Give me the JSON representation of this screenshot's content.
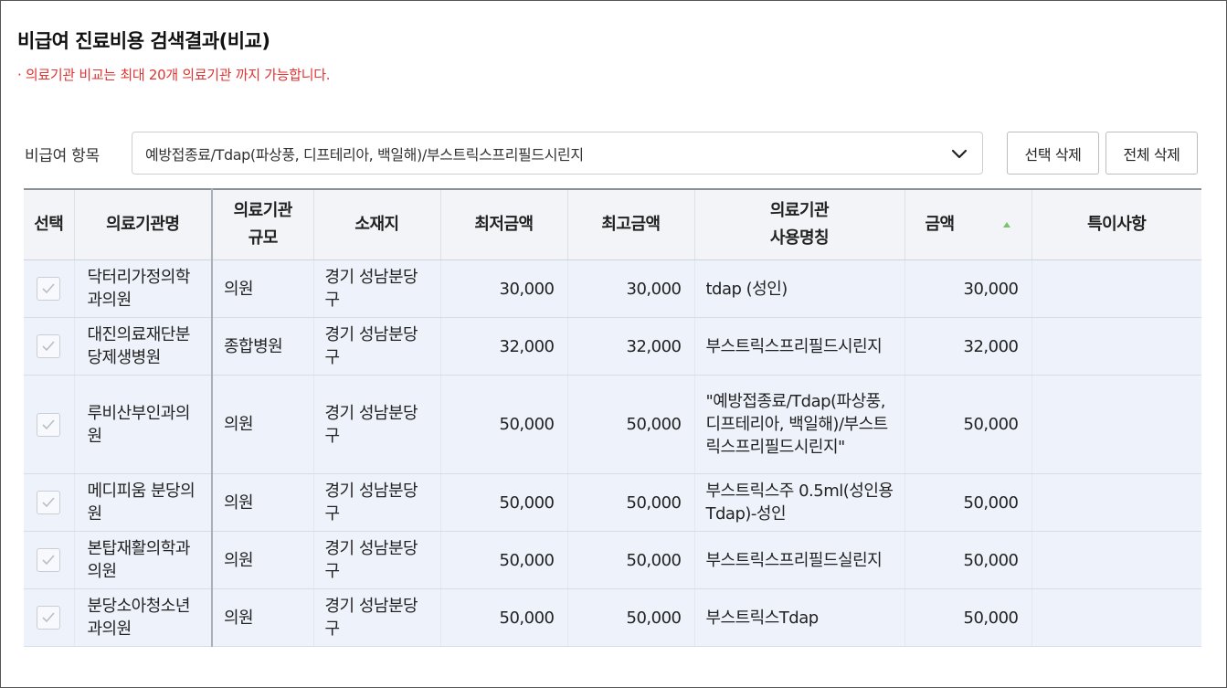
{
  "page": {
    "title": "비급여 진료비용 검색결과(비교)",
    "notice": "· 의료기관 비교는 최대 20개 의료기관 까지 가능합니다."
  },
  "filter": {
    "label": "비급여 항목",
    "selected": "예방접종료/Tdap(파상풍, 디프테리아, 백일해)/부스트릭스프리필드시린지",
    "icon": "chevron-down-icon"
  },
  "buttons": {
    "delete_selected": "선택 삭제",
    "delete_all": "전체 삭제"
  },
  "table": {
    "headers": {
      "select": "선택",
      "name": "의료기관명",
      "size_line1": "의료기관",
      "size_line2": "규모",
      "location": "소재지",
      "min_price": "최저금액",
      "max_price": "최고금액",
      "usage_name_line1": "의료기관",
      "usage_name_line2": "사용명칭",
      "amount": "금액",
      "notes": "특이사항"
    },
    "sort": {
      "column": "amount",
      "direction": "ascending",
      "icon": "sort-up-icon",
      "color": "#7cc46b"
    },
    "rows": [
      {
        "checked": true,
        "name": "닥터리가정의학과의원",
        "size": "의원",
        "location": "경기 성남분당구",
        "min_price": "30,000",
        "max_price": "30,000",
        "usage_name": "tdap (성인)",
        "amount": "30,000",
        "notes": ""
      },
      {
        "checked": true,
        "name": "대진의료재단분당제생병원",
        "size": "종합병원",
        "location": "경기 성남분당구",
        "min_price": "32,000",
        "max_price": "32,000",
        "usage_name": "부스트릭스프리필드시린지",
        "amount": "32,000",
        "notes": ""
      },
      {
        "checked": true,
        "name": "루비산부인과의원",
        "size": "의원",
        "location": "경기 성남분당구",
        "min_price": "50,000",
        "max_price": "50,000",
        "usage_name": "\"예방접종료/Tdap(파상풍, 디프테리아, 백일해)/부스트릭스프리필드시린지\"",
        "amount": "50,000",
        "notes": ""
      },
      {
        "checked": true,
        "name": "메디피움 분당의원",
        "size": "의원",
        "location": "경기 성남분당구",
        "min_price": "50,000",
        "max_price": "50,000",
        "usage_name": "부스트릭스주 0.5ml(성인용 Tdap)-성인",
        "amount": "50,000",
        "notes": ""
      },
      {
        "checked": true,
        "name": "본탑재활의학과의원",
        "size": "의원",
        "location": "경기 성남분당구",
        "min_price": "50,000",
        "max_price": "50,000",
        "usage_name": "부스트릭스프리필드실린지",
        "amount": "50,000",
        "notes": ""
      },
      {
        "checked": true,
        "name": "분당소아청소년과의원",
        "size": "의원",
        "location": "경기 성남분당구",
        "min_price": "50,000",
        "max_price": "50,000",
        "usage_name": "부스트릭스Tdap",
        "amount": "50,000",
        "notes": ""
      }
    ]
  }
}
